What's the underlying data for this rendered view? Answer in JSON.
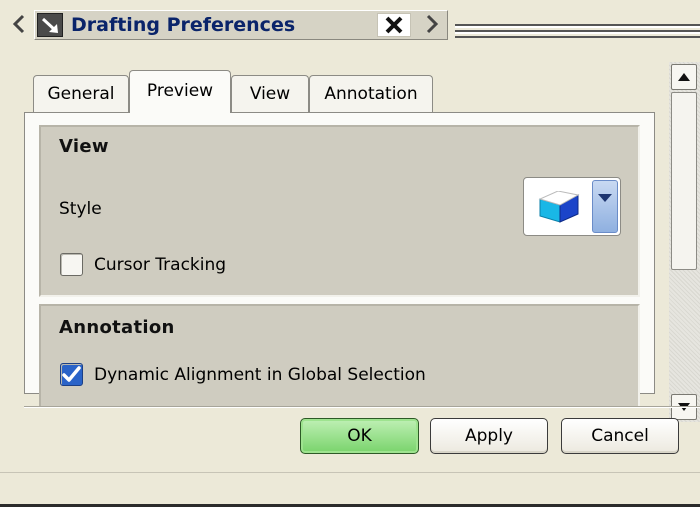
{
  "window": {
    "title": "Drafting Preferences",
    "icons": {
      "prev": "chevron-left-icon",
      "next": "chevron-right-icon",
      "app": "drafting-arrow-icon",
      "close": "close-icon"
    }
  },
  "tabs": [
    {
      "label": "General",
      "active": false
    },
    {
      "label": "Preview",
      "active": true
    },
    {
      "label": "View",
      "active": false
    },
    {
      "label": "Annotation",
      "active": false
    }
  ],
  "view_group": {
    "title": "View",
    "style_label": "Style",
    "style_icon": "shaded-book-icon",
    "cursor_tracking": {
      "label": "Cursor Tracking",
      "checked": false
    }
  },
  "annotation_group": {
    "title": "Annotation",
    "dynamic_alignment": {
      "label": "Dynamic Alignment in Global Selection",
      "checked": true
    }
  },
  "buttons": {
    "ok": "OK",
    "apply": "Apply",
    "cancel": "Cancel"
  },
  "colors": {
    "title_text": "#0a246a",
    "ok_button": "#79d36b",
    "checkbox_checked": "#2a63c8",
    "style_icon_fill": "#19b7e6"
  }
}
